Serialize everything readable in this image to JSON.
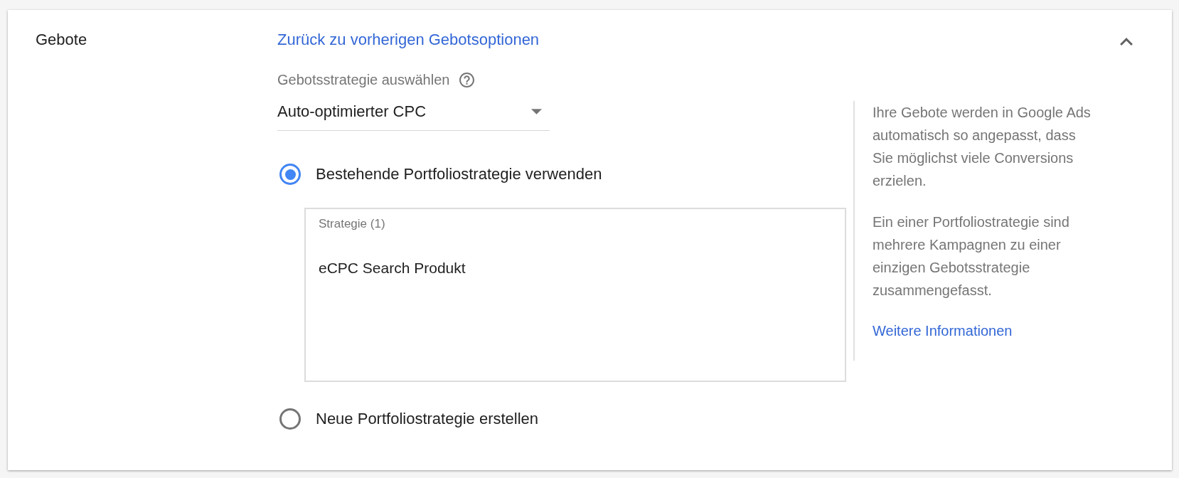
{
  "section": {
    "title": "Gebote",
    "expanded": true,
    "back_link": "Zurück zu vorherigen Gebotsoptionen"
  },
  "strategy_select": {
    "label": "Gebotsstrategie auswählen",
    "value": "Auto-optimierter CPC"
  },
  "options": [
    {
      "label": "Bestehende Portfoliostrategie verwenden",
      "selected": true,
      "list": {
        "header": "Strategie (1)",
        "items": [
          {
            "label": "eCPC Search Produkt",
            "selected": false
          }
        ]
      }
    },
    {
      "label": "Neue Portfoliostrategie erstellen",
      "selected": false
    }
  ],
  "help": {
    "paragraphs": [
      "Ihre Gebote werden in Google Ads automatisch so angepasst, dass Sie möglichst viele Conversions erzielen.",
      "Ein einer Portfoliostrategie sind mehrere Kampagnen zu einer einzigen Gebotsstrategie zusammengefasst."
    ],
    "link": "Weitere Informationen"
  }
}
